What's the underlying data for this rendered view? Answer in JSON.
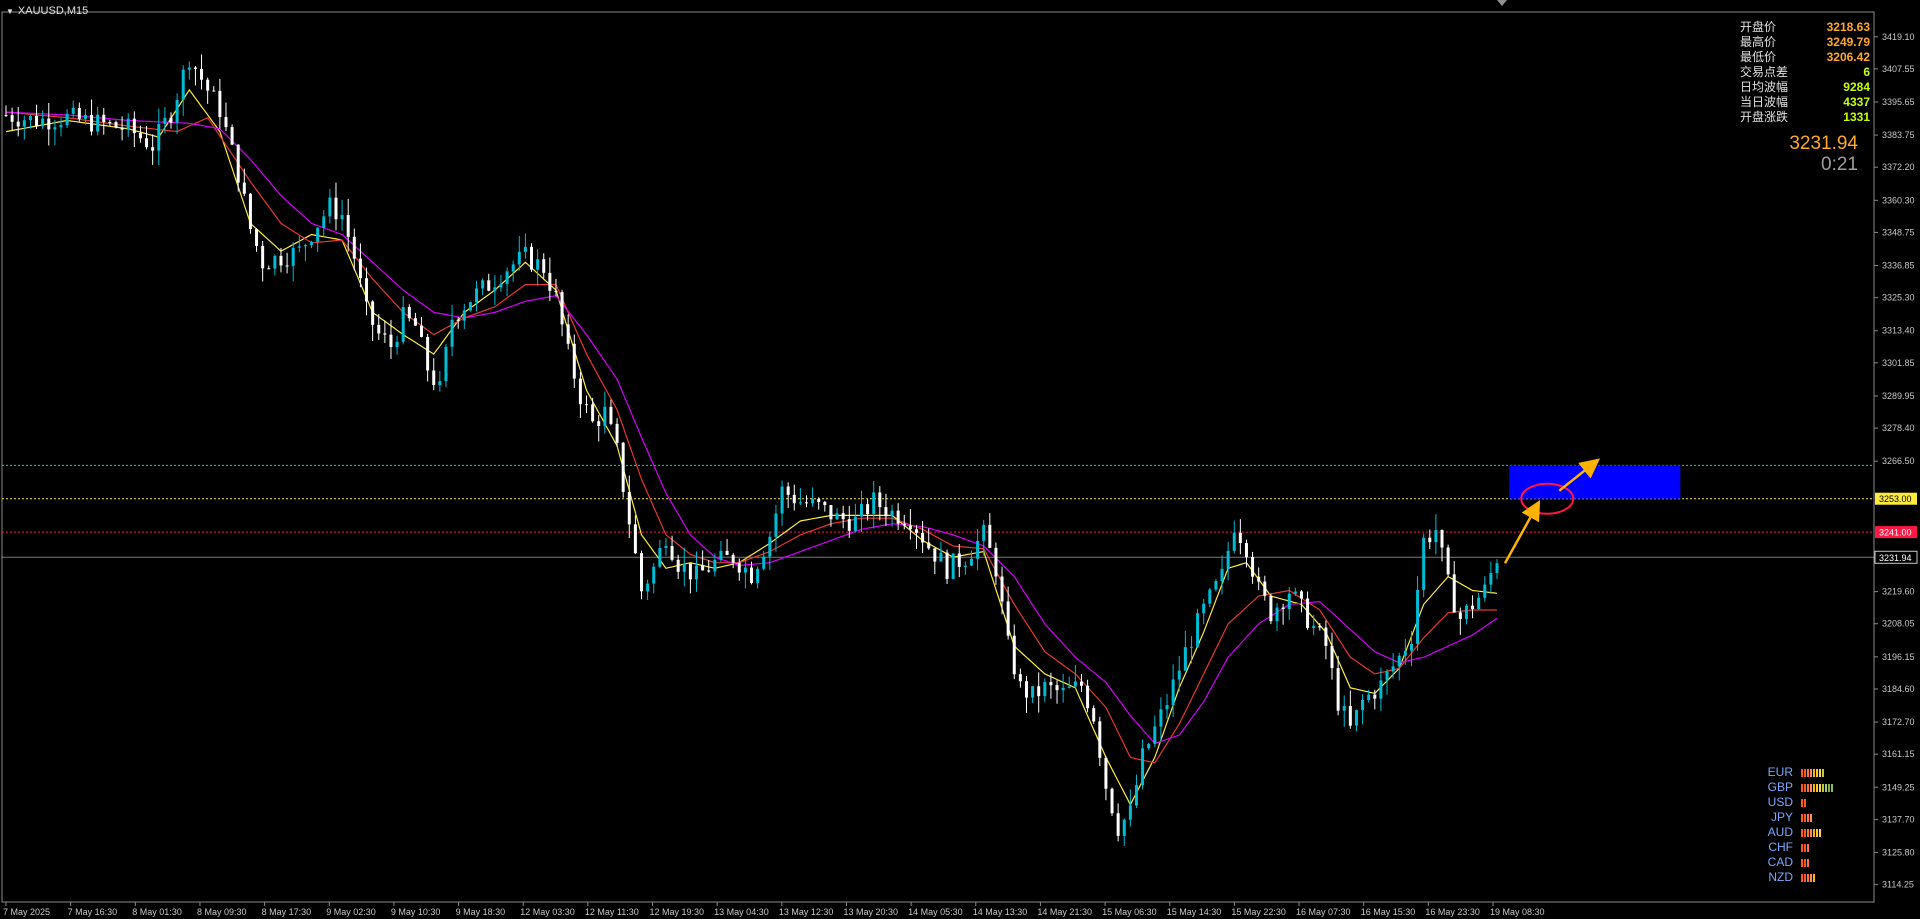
{
  "symbol_title": "XAUUSD,M15",
  "info": {
    "rows": [
      {
        "label": "开盘价",
        "value": "3218.63",
        "color": "#ffa726"
      },
      {
        "label": "最高价",
        "value": "3249.79",
        "color": "#ffa726"
      },
      {
        "label": "最低价",
        "value": "3206.42",
        "color": "#ffa726"
      },
      {
        "label": "交易点差",
        "value": "6",
        "color": "#c6ff00"
      },
      {
        "label": "日均波幅",
        "value": "9284",
        "color": "#c6ff00"
      },
      {
        "label": "当日波幅",
        "value": "4337",
        "color": "#c6ff00"
      },
      {
        "label": "开盘涨跌",
        "value": "1331",
        "color": "#c6ff00"
      }
    ],
    "current_price": "3231.94",
    "countdown": "0:21"
  },
  "chart_data": {
    "type": "candlestick",
    "symbol": "XAUUSD",
    "timeframe": "M15",
    "ylim": [
      3108,
      3428
    ],
    "y_ticks": [
      "3419.10",
      "3407.55",
      "3395.65",
      "3383.75",
      "3372.20",
      "3360.30",
      "3348.75",
      "3336.85",
      "3325.30",
      "3313.40",
      "3301.85",
      "3289.95",
      "3278.40",
      "3266.50",
      "3253.00",
      "3241.00",
      "3231.94",
      "3219.60",
      "3208.05",
      "3196.15",
      "3184.60",
      "3172.70",
      "3161.15",
      "3149.25",
      "3137.70",
      "3125.80",
      "3114.25"
    ],
    "x_ticks": [
      "7 May 2025",
      "7 May 16:30",
      "8 May 01:30",
      "8 May 09:30",
      "8 May 17:30",
      "9 May 02:30",
      "9 May 10:30",
      "9 May 18:30",
      "12 May 03:30",
      "12 May 11:30",
      "12 May 19:30",
      "13 May 04:30",
      "13 May 12:30",
      "13 May 20:30",
      "14 May 05:30",
      "14 May 13:30",
      "14 May 21:30",
      "15 May 06:30",
      "15 May 14:30",
      "15 May 22:30",
      "16 May 07:30",
      "16 May 15:30",
      "16 May 23:30",
      "19 May 08:30"
    ],
    "price_path": [
      [
        0,
        3391
      ],
      [
        5,
        3389
      ],
      [
        10,
        3390
      ],
      [
        15,
        3388
      ],
      [
        20,
        3386
      ],
      [
        24,
        3380
      ],
      [
        27,
        3392
      ],
      [
        30,
        3412
      ],
      [
        33,
        3400
      ],
      [
        35,
        3393
      ],
      [
        38,
        3370
      ],
      [
        40,
        3350
      ],
      [
        42,
        3338
      ],
      [
        45,
        3340
      ],
      [
        48,
        3342
      ],
      [
        51,
        3352
      ],
      [
        53,
        3358
      ],
      [
        55,
        3355
      ],
      [
        57,
        3340
      ],
      [
        59,
        3320
      ],
      [
        61,
        3312
      ],
      [
        63,
        3308
      ],
      [
        65,
        3318
      ],
      [
        67,
        3315
      ],
      [
        69,
        3300
      ],
      [
        71,
        3292
      ],
      [
        73,
        3318
      ],
      [
        76,
        3325
      ],
      [
        79,
        3330
      ],
      [
        82,
        3336
      ],
      [
        85,
        3340
      ],
      [
        88,
        3336
      ],
      [
        90,
        3325
      ],
      [
        92,
        3305
      ],
      [
        94,
        3290
      ],
      [
        96,
        3280
      ],
      [
        98,
        3284
      ],
      [
        100,
        3270
      ],
      [
        102,
        3245
      ],
      [
        104,
        3220
      ],
      [
        106,
        3228
      ],
      [
        108,
        3240
      ],
      [
        110,
        3230
      ],
      [
        113,
        3225
      ],
      [
        116,
        3230
      ],
      [
        119,
        3232
      ],
      [
        122,
        3226
      ],
      [
        125,
        3240
      ],
      [
        127,
        3256
      ],
      [
        130,
        3252
      ],
      [
        133,
        3250
      ],
      [
        136,
        3246
      ],
      [
        139,
        3245
      ],
      [
        142,
        3252
      ],
      [
        145,
        3248
      ],
      [
        148,
        3246
      ],
      [
        151,
        3236
      ],
      [
        154,
        3228
      ],
      [
        157,
        3232
      ],
      [
        160,
        3240
      ],
      [
        162,
        3228
      ],
      [
        164,
        3200
      ],
      [
        166,
        3185
      ],
      [
        168,
        3182
      ],
      [
        170,
        3185
      ],
      [
        173,
        3183
      ],
      [
        176,
        3186
      ],
      [
        178,
        3175
      ],
      [
        180,
        3150
      ],
      [
        182,
        3135
      ],
      [
        184,
        3140
      ],
      [
        186,
        3160
      ],
      [
        188,
        3170
      ],
      [
        190,
        3180
      ],
      [
        193,
        3198
      ],
      [
        196,
        3213
      ],
      [
        199,
        3225
      ],
      [
        201,
        3244
      ],
      [
        203,
        3236
      ],
      [
        205,
        3220
      ],
      [
        207,
        3212
      ],
      [
        210,
        3220
      ],
      [
        213,
        3210
      ],
      [
        216,
        3200
      ],
      [
        218,
        3180
      ],
      [
        220,
        3170
      ],
      [
        222,
        3180
      ],
      [
        225,
        3186
      ],
      [
        228,
        3196
      ],
      [
        230,
        3204
      ],
      [
        232,
        3238
      ],
      [
        234,
        3242
      ],
      [
        236,
        3222
      ],
      [
        238,
        3210
      ],
      [
        240,
        3215
      ],
      [
        242,
        3220
      ],
      [
        244,
        3231.94
      ]
    ],
    "moving_averages": [
      {
        "period": "fast",
        "color": "#ffeb3b",
        "path": [
          [
            0,
            3385
          ],
          [
            10,
            3389
          ],
          [
            20,
            3386
          ],
          [
            25,
            3383
          ],
          [
            30,
            3400
          ],
          [
            35,
            3385
          ],
          [
            40,
            3352
          ],
          [
            45,
            3342
          ],
          [
            50,
            3348
          ],
          [
            55,
            3346
          ],
          [
            60,
            3320
          ],
          [
            65,
            3312
          ],
          [
            70,
            3305
          ],
          [
            75,
            3320
          ],
          [
            80,
            3328
          ],
          [
            85,
            3338
          ],
          [
            90,
            3328
          ],
          [
            95,
            3292
          ],
          [
            100,
            3272
          ],
          [
            104,
            3240
          ],
          [
            108,
            3228
          ],
          [
            112,
            3230
          ],
          [
            116,
            3228
          ],
          [
            120,
            3230
          ],
          [
            125,
            3237
          ],
          [
            130,
            3245
          ],
          [
            135,
            3247
          ],
          [
            140,
            3247
          ],
          [
            145,
            3247
          ],
          [
            150,
            3238
          ],
          [
            155,
            3232
          ],
          [
            160,
            3234
          ],
          [
            165,
            3200
          ],
          [
            170,
            3190
          ],
          [
            175,
            3185
          ],
          [
            180,
            3160
          ],
          [
            184,
            3143
          ],
          [
            188,
            3160
          ],
          [
            192,
            3185
          ],
          [
            196,
            3205
          ],
          [
            200,
            3228
          ],
          [
            203,
            3230
          ],
          [
            207,
            3218
          ],
          [
            212,
            3215
          ],
          [
            216,
            3205
          ],
          [
            220,
            3185
          ],
          [
            224,
            3183
          ],
          [
            228,
            3192
          ],
          [
            232,
            3215
          ],
          [
            236,
            3225
          ],
          [
            240,
            3220
          ],
          [
            244,
            3219
          ]
        ]
      },
      {
        "period": "mid",
        "color": "#e53935",
        "path": [
          [
            0,
            3392
          ],
          [
            10,
            3390
          ],
          [
            20,
            3387
          ],
          [
            28,
            3385
          ],
          [
            33,
            3390
          ],
          [
            40,
            3367
          ],
          [
            45,
            3352
          ],
          [
            50,
            3345
          ],
          [
            55,
            3346
          ],
          [
            60,
            3332
          ],
          [
            65,
            3320
          ],
          [
            70,
            3312
          ],
          [
            75,
            3318
          ],
          [
            80,
            3322
          ],
          [
            85,
            3330
          ],
          [
            90,
            3330
          ],
          [
            95,
            3305
          ],
          [
            100,
            3285
          ],
          [
            104,
            3260
          ],
          [
            108,
            3240
          ],
          [
            112,
            3233
          ],
          [
            116,
            3230
          ],
          [
            120,
            3230
          ],
          [
            125,
            3234
          ],
          [
            130,
            3240
          ],
          [
            135,
            3244
          ],
          [
            140,
            3246
          ],
          [
            145,
            3246
          ],
          [
            150,
            3242
          ],
          [
            155,
            3236
          ],
          [
            160,
            3235
          ],
          [
            165,
            3215
          ],
          [
            170,
            3198
          ],
          [
            175,
            3190
          ],
          [
            180,
            3178
          ],
          [
            184,
            3160
          ],
          [
            188,
            3158
          ],
          [
            192,
            3172
          ],
          [
            196,
            3190
          ],
          [
            200,
            3208
          ],
          [
            205,
            3218
          ],
          [
            210,
            3220
          ],
          [
            215,
            3213
          ],
          [
            220,
            3196
          ],
          [
            224,
            3190
          ],
          [
            228,
            3192
          ],
          [
            232,
            3203
          ],
          [
            236,
            3212
          ],
          [
            240,
            3213
          ],
          [
            244,
            3213
          ]
        ]
      },
      {
        "period": "slow",
        "color": "#d500f9",
        "path": [
          [
            0,
            3392
          ],
          [
            10,
            3391
          ],
          [
            20,
            3389
          ],
          [
            30,
            3388
          ],
          [
            35,
            3386
          ],
          [
            40,
            3375
          ],
          [
            45,
            3362
          ],
          [
            50,
            3352
          ],
          [
            55,
            3348
          ],
          [
            60,
            3338
          ],
          [
            65,
            3328
          ],
          [
            70,
            3320
          ],
          [
            75,
            3318
          ],
          [
            80,
            3320
          ],
          [
            85,
            3324
          ],
          [
            90,
            3326
          ],
          [
            95,
            3312
          ],
          [
            100,
            3296
          ],
          [
            104,
            3275
          ],
          [
            108,
            3255
          ],
          [
            112,
            3240
          ],
          [
            116,
            3232
          ],
          [
            120,
            3229
          ],
          [
            125,
            3230
          ],
          [
            130,
            3234
          ],
          [
            135,
            3238
          ],
          [
            140,
            3242
          ],
          [
            145,
            3244
          ],
          [
            150,
            3243
          ],
          [
            155,
            3240
          ],
          [
            160,
            3236
          ],
          [
            165,
            3225
          ],
          [
            170,
            3208
          ],
          [
            175,
            3196
          ],
          [
            180,
            3187
          ],
          [
            184,
            3175
          ],
          [
            188,
            3165
          ],
          [
            192,
            3168
          ],
          [
            196,
            3180
          ],
          [
            200,
            3196
          ],
          [
            205,
            3208
          ],
          [
            210,
            3215
          ],
          [
            215,
            3216
          ],
          [
            220,
            3206
          ],
          [
            224,
            3198
          ],
          [
            228,
            3194
          ],
          [
            232,
            3196
          ],
          [
            236,
            3200
          ],
          [
            240,
            3204
          ],
          [
            244,
            3210
          ]
        ]
      }
    ],
    "horizontal_lines": [
      {
        "label": "3265.00",
        "color": "#00e676",
        "value": 3265.0
      },
      {
        "label": "3253.00",
        "color": "#ffeb3b",
        "value": 3253.0
      },
      {
        "label": "3241.00",
        "color": "#ff1744",
        "value": 3241.0
      },
      {
        "label": "3231.94",
        "color": "#c8c8c8",
        "value": 3231.94
      }
    ],
    "target_zone": {
      "color": "#0000ff",
      "price_low": 3253.0,
      "price_high": 3265.0,
      "x_from": 246,
      "x_to": 274
    },
    "bull_color": "#00bcd4",
    "bear_color": "#ffffff"
  },
  "strength": {
    "rows": [
      {
        "currency": "EUR",
        "bars": [
          "#ff5722",
          "#ff5722",
          "#ff7043",
          "#ff8a65",
          "#ffb300",
          "#ffca28",
          "#ffd54f",
          "#c0ca33"
        ]
      },
      {
        "currency": "GBP",
        "bars": [
          "#ff5722",
          "#ff5722",
          "#ff7043",
          "#ff8a65",
          "#ffb300",
          "#ffca28",
          "#ffd54f",
          "#c0ca33",
          "#9ccc65",
          "#7cb342",
          "#8bc34a"
        ]
      },
      {
        "currency": "USD",
        "bars": [
          "#ff5722",
          "#ff5722"
        ]
      },
      {
        "currency": "JPY",
        "bars": [
          "#ff5722",
          "#ff5722",
          "#ff7043",
          "#ff8a65"
        ]
      },
      {
        "currency": "AUD",
        "bars": [
          "#ff5722",
          "#ff5722",
          "#ff7043",
          "#ff8a65",
          "#ffb300",
          "#ffca28",
          "#ffd54f"
        ]
      },
      {
        "currency": "CHF",
        "bars": [
          "#ff5722",
          "#ff5722",
          "#ff7043"
        ]
      },
      {
        "currency": "CAD",
        "bars": [
          "#ff5722",
          "#ff5722",
          "#ff7043"
        ]
      },
      {
        "currency": "NZD",
        "bars": [
          "#ff5722",
          "#ff5722",
          "#ff7043",
          "#ff8a65",
          "#ffb300"
        ]
      }
    ]
  }
}
